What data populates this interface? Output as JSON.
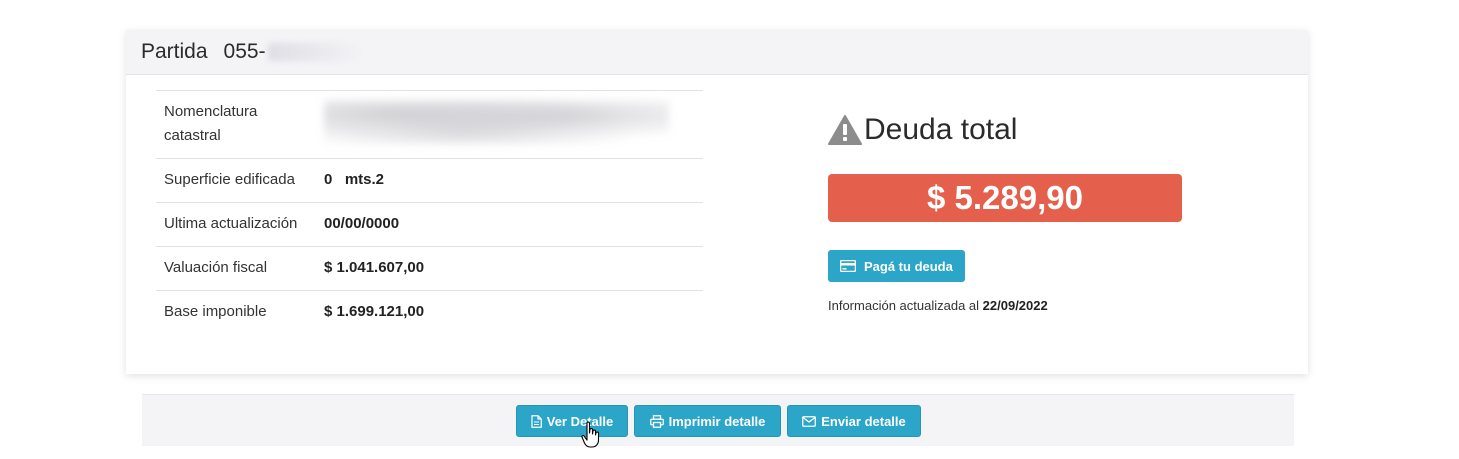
{
  "header": {
    "label": "Partida",
    "number": "055-"
  },
  "info_rows": [
    {
      "key": "Nomenclatura catastral",
      "value": ""
    },
    {
      "key": "Superficie edificada",
      "value": "0   mts.2"
    },
    {
      "key": "Ultima actualización",
      "value": "00/00/0000"
    },
    {
      "key": "Valuación fiscal",
      "value": "$ 1.041.607,00"
    },
    {
      "key": "Base imponible",
      "value": "$ 1.699.121,00"
    }
  ],
  "debt": {
    "title": "Deuda total",
    "amount": "$ 5.289,90",
    "pay_button": "Pagá tu deuda",
    "updated_prefix": "Información actualizada al",
    "updated_date": "22/09/2022"
  },
  "footer": {
    "view_detail": "Ver Detalle",
    "print_detail": "Imprimir detalle",
    "send_detail": "Enviar detalle"
  },
  "colors": {
    "accent": "#2ba5c8",
    "debt_red": "#e4604d"
  }
}
